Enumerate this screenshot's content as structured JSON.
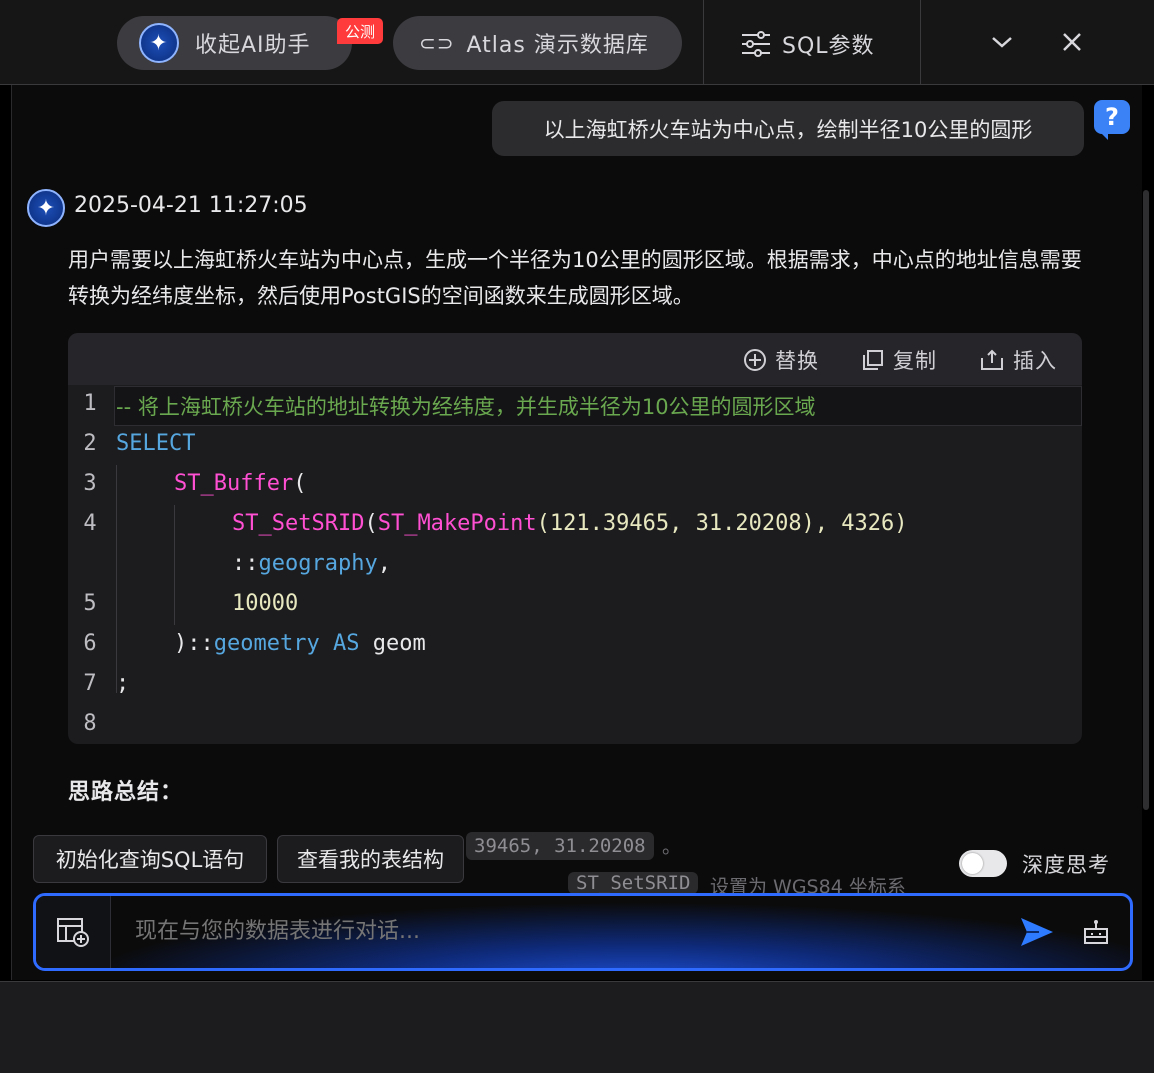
{
  "header": {
    "ai_button_label": "收起AI助手",
    "beta_badge": "公测",
    "db_button_label": "Atlas 演示数据库",
    "sql_params_label": "SQL参数",
    "icons": [
      "sparkle-icon",
      "link-icon",
      "sliders-icon",
      "chevron-down-icon",
      "close-icon"
    ]
  },
  "chat": {
    "user_message": "以上海虹桥火车站为中心点，绘制半径10公里的圆形",
    "timestamp": "2025-04-21 11:27:05",
    "response_text": "用户需要以上海虹桥火车站为中心点，生成一个半径为10公里的圆形区域。根据需求，中心点的地址信息需要转换为经纬度坐标，然后使用PostGIS的空间函数来生成圆形区域。",
    "code_actions": {
      "replace": "替换",
      "copy": "复制",
      "insert": "插入"
    },
    "code": {
      "line_numbers": [
        "1",
        "2",
        "3",
        "4",
        "",
        "5",
        "6",
        "7",
        "8"
      ],
      "line1": "-- 将上海虹桥火车站的地址转换为经纬度，并生成半径为10公里的圆形区域",
      "line2_kw": "SELECT",
      "line3_fn": "ST_Buffer",
      "line3_p": "(",
      "line4_fn1": "ST_SetSRID",
      "line4_p1": "(",
      "line4_fn2": "ST_MakePoint",
      "line4_args": "(121.39465, 31.20208), 4326)",
      "line4b_colons": "::",
      "line4b_type": "geography",
      "line4b_comma": ",",
      "line5": "10000",
      "line6_p": ")::",
      "line6_type": "geometry",
      "line6_as": "AS",
      "line6_alias": "geom",
      "line7": ";"
    },
    "summary_title": "思路总结：",
    "partial_code_1": "39465, 31.20208",
    "partial_after_1": "。",
    "partial_code_2": "ST_SetSRID",
    "partial_text_2": "设置为 WGS84 坐标系"
  },
  "quick_actions": [
    "初始化查询SQL语句",
    "查看我的表结构"
  ],
  "deep_thinking": {
    "label": "深度思考",
    "enabled": false
  },
  "input": {
    "placeholder": "现在与您的数据表进行对话..."
  },
  "colors": {
    "accent": "#2f6bff",
    "badge": "#ff3b3b",
    "comment": "#6aa84f",
    "keyword": "#56a7e0",
    "function": "#ff4fd2"
  }
}
